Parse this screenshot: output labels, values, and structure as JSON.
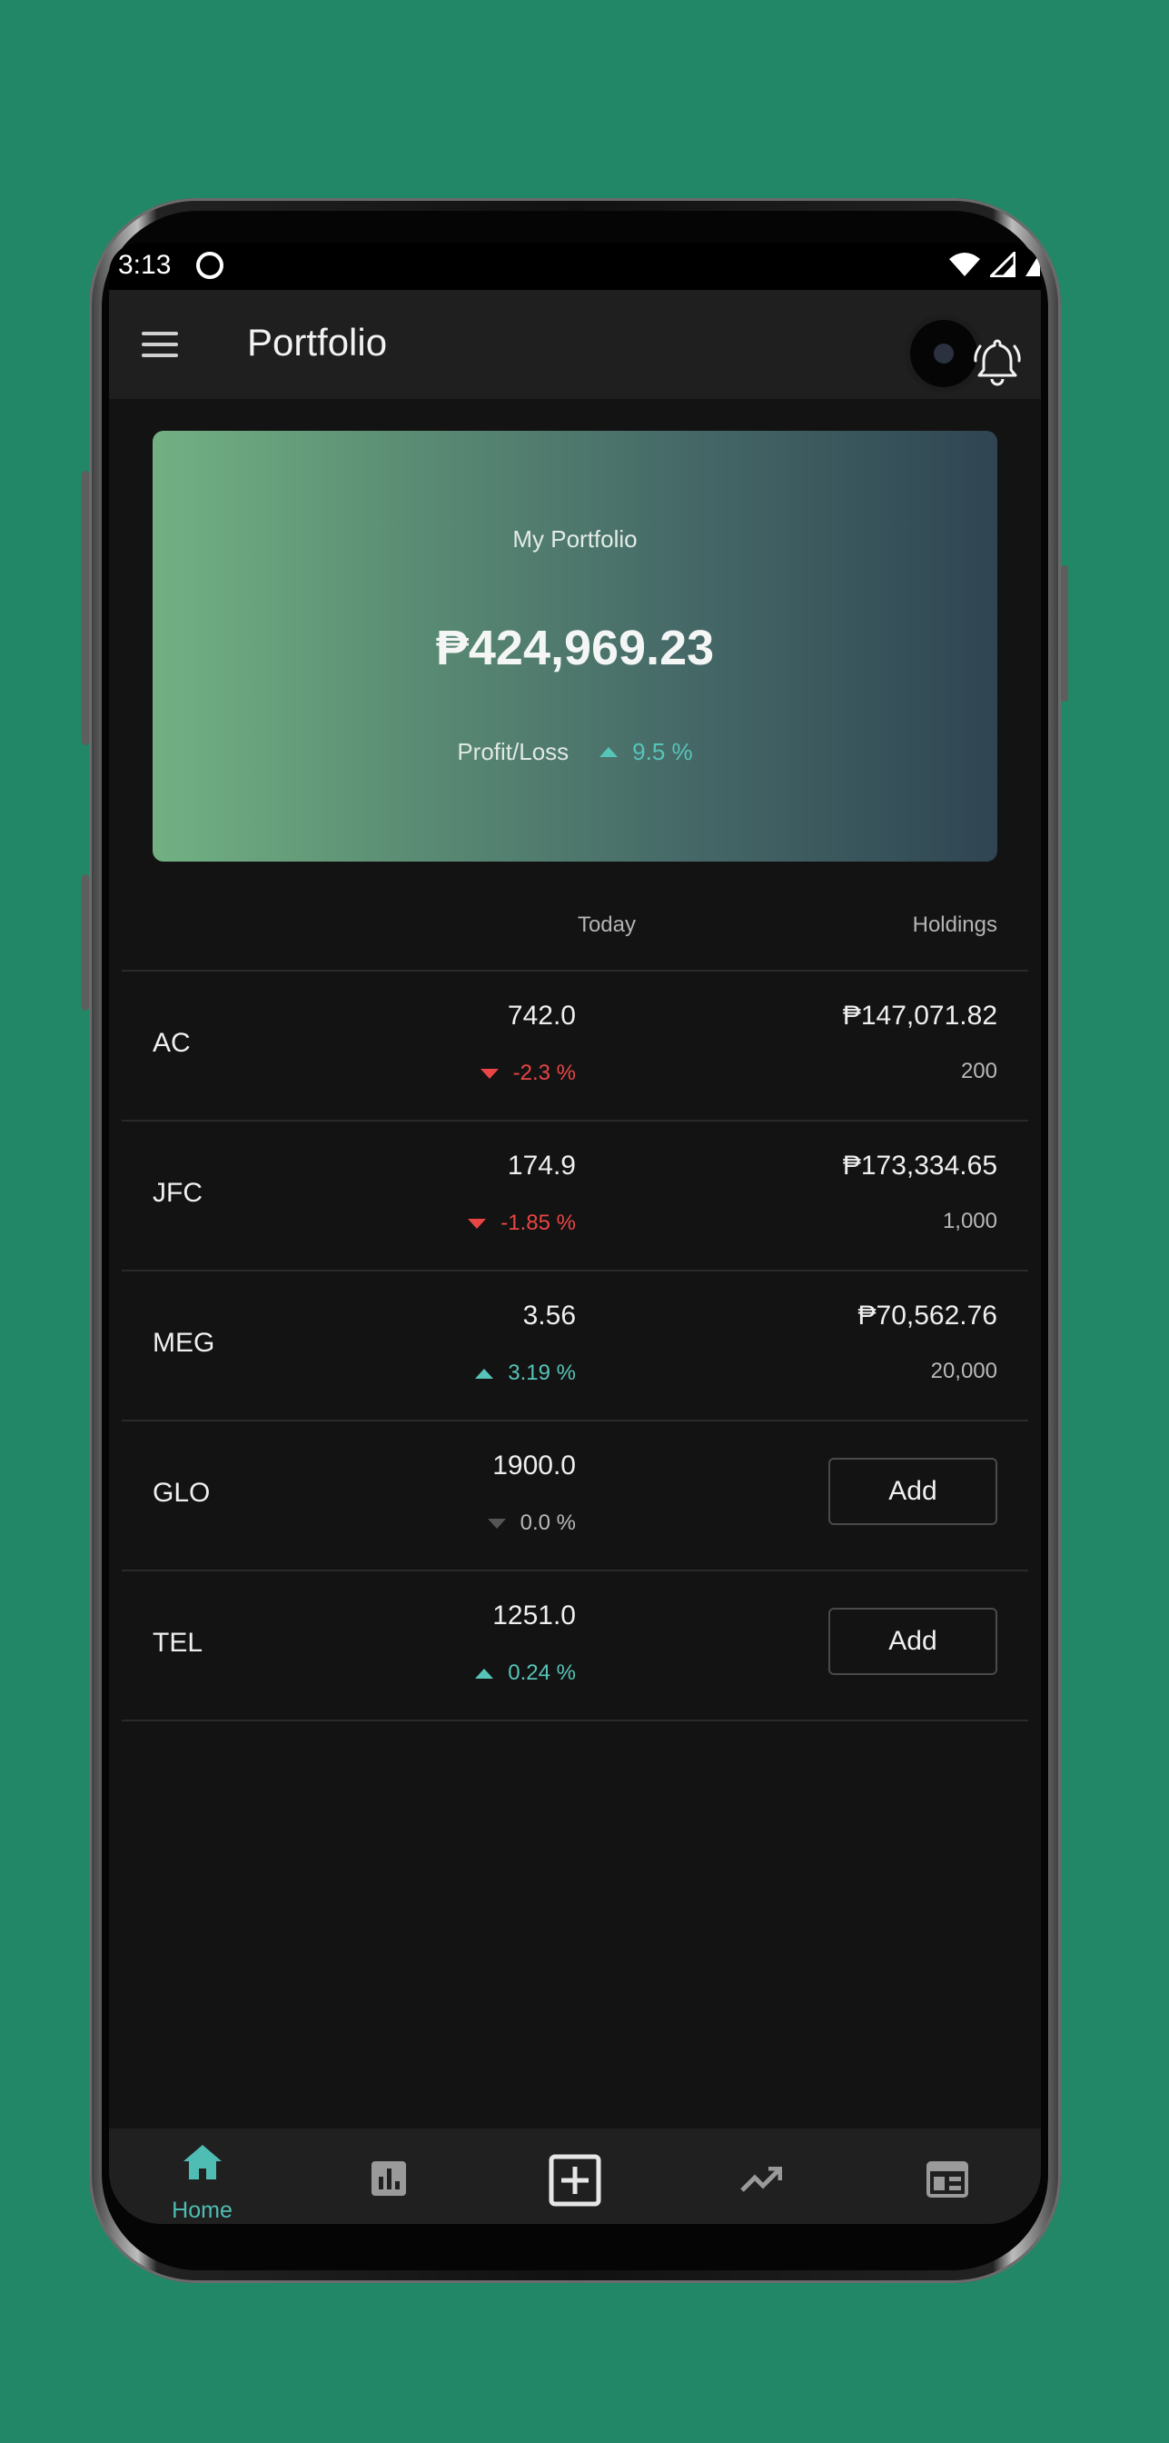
{
  "statusbar": {
    "time": "3:13"
  },
  "appbar": {
    "title": "Portfolio"
  },
  "portfolio_card": {
    "label": "My Portfolio",
    "amount": "₱424,969.23",
    "pl_label": "Profit/Loss",
    "pl_value": "9.5 %"
  },
  "columns": {
    "today": "Today",
    "holdings": "Holdings"
  },
  "stocks": [
    {
      "symbol": "AC",
      "price": "742.0",
      "change": "-2.3 %",
      "direction": "down",
      "holding_value": "₱147,071.82",
      "holding_qty": "200"
    },
    {
      "symbol": "JFC",
      "price": "174.9",
      "change": "-1.85 %",
      "direction": "down",
      "holding_value": "₱173,334.65",
      "holding_qty": "1,000"
    },
    {
      "symbol": "MEG",
      "price": "3.56",
      "change": "3.19 %",
      "direction": "up",
      "holding_value": "₱70,562.76",
      "holding_qty": "20,000"
    },
    {
      "symbol": "GLO",
      "price": "1900.0",
      "change": "0.0 %",
      "direction": "flat",
      "add_label": "Add"
    },
    {
      "symbol": "TEL",
      "price": "1251.0",
      "change": "0.24 %",
      "direction": "up",
      "add_label": "Add"
    }
  ],
  "navbar": {
    "items": [
      {
        "label": "Home",
        "icon": "home-icon",
        "active": true
      },
      {
        "icon": "bar-chart-icon"
      },
      {
        "icon": "add-box-icon"
      },
      {
        "icon": "trending-up-icon"
      },
      {
        "icon": "newspaper-icon"
      }
    ]
  },
  "colors": {
    "background": "#228766",
    "accent": "#4fbdb3",
    "up": "#57c4b9",
    "down": "#ea4545",
    "screen": "#131313"
  }
}
